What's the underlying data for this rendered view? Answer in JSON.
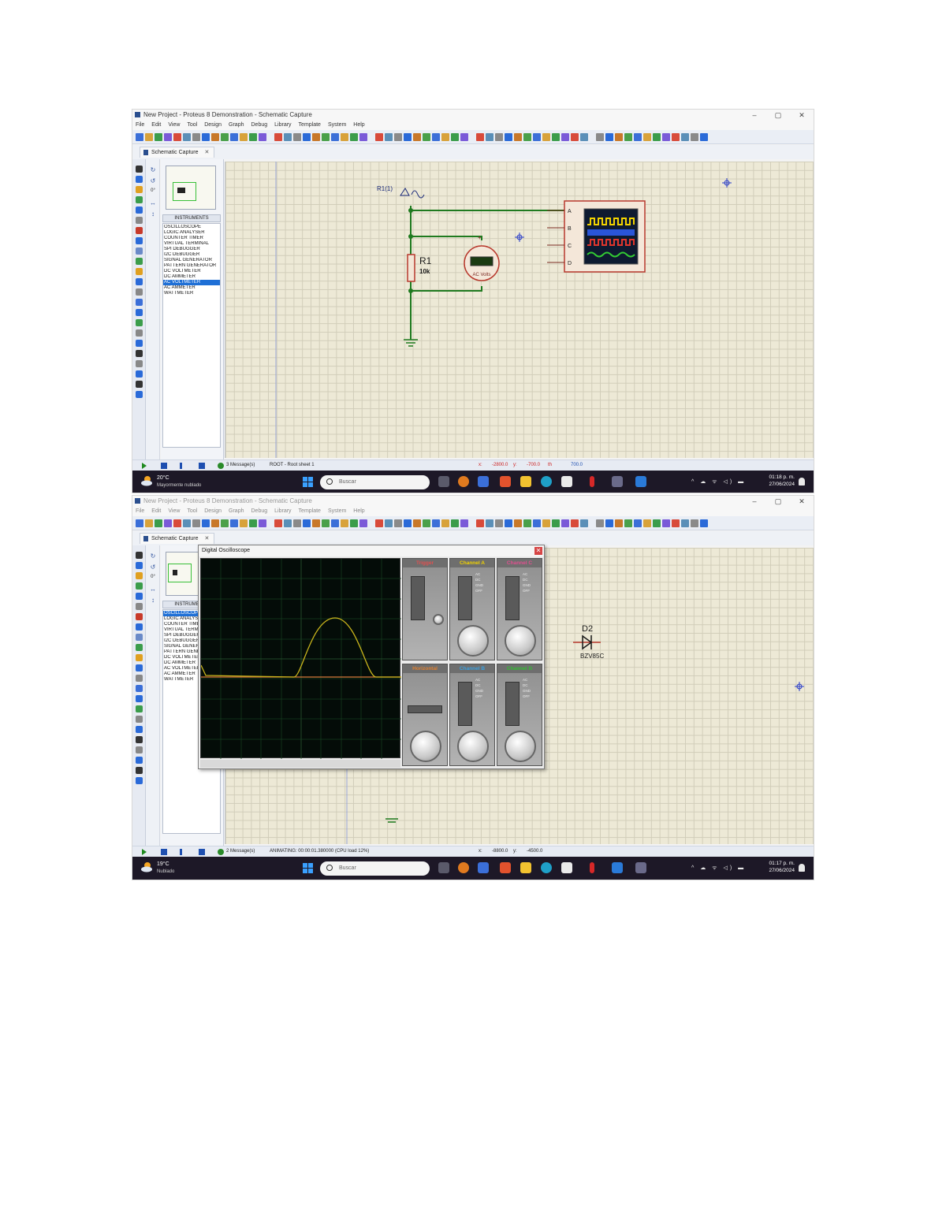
{
  "screenshots": [
    {
      "window_title": "New Project - Proteus 8 Demonstration - Schematic Capture",
      "window_controls": [
        "–",
        "▢",
        "✕"
      ],
      "menu": [
        "File",
        "Edit",
        "View",
        "Tool",
        "Design",
        "Graph",
        "Debug",
        "Library",
        "Template",
        "System",
        "Help"
      ],
      "tab_label": "Schematic Capture",
      "tab_close": "✕",
      "panel_header": "INSTRUMENTS",
      "instruments": [
        "OSCILLOSCOPE",
        "LOGIC ANALYSER",
        "COUNTER TIMER",
        "VIRTUAL TERMINAL",
        "SPI DEBUGGER",
        "I2C DEBUGGER",
        "SIGNAL GENERATOR",
        "PATTERN GENERATOR",
        "DC VOLTMETER",
        "DC AMMETER",
        "AC VOLTMETER",
        "AC AMMETER",
        "WATTMETER"
      ],
      "selected_instrument": "AC VOLTMETER",
      "rotation_value": "0°",
      "schematic": {
        "source_label": "R1(1)",
        "resistor_name": "R1",
        "resistor_value": "10k",
        "meter_label": "AC Volts",
        "scope_channels": [
          "A",
          "B",
          "C",
          "D"
        ]
      },
      "status": {
        "messages": "3 Message(s)",
        "sheet": "ROOT - Root sheet 1",
        "coord_x_label": "x:",
        "coord_x": "-2800.0",
        "coord_y_label": "y:",
        "coord_y": "-700.0",
        "units": "th",
        "extra": "700.0"
      },
      "taskbar": {
        "temperature": "20°C",
        "weather": "Mayormente nublado",
        "search_placeholder": "Buscar",
        "time": "01:18 p. m.",
        "date": "27/06/2024"
      }
    },
    {
      "window_title": "New Project - Proteus 8 Demonstration - Schematic Capture",
      "window_controls": [
        "–",
        "▢",
        "✕"
      ],
      "menu": [
        "File",
        "Edit",
        "View",
        "Tool",
        "Design",
        "Graph",
        "Debug",
        "Library",
        "Template",
        "System",
        "Help"
      ],
      "tab_label": "Schematic Capture",
      "tab_close": "✕",
      "panel_header": "INSTRUMENTS",
      "instruments": [
        "OSCILLOSCOPE",
        "LOGIC ANALYSER",
        "COUNTER TIMER",
        "VIRTUAL TERMINAL",
        "SPI DEBUGGER",
        "I2C DEBUGGER",
        "SIGNAL GENERATOR",
        "PATTERN GENERATOR",
        "DC VOLTMETER",
        "DC AMMETER",
        "AC VOLTMETER",
        "AC AMMETER",
        "WATTMETER"
      ],
      "selected_instrument": "OSCILLOSCOPE",
      "rotation_value": "0°",
      "schematic": {
        "diode_name": "D2",
        "diode_part": "BZV85C"
      },
      "scope": {
        "title": "Digital Oscilloscope",
        "close": "✕",
        "panels": [
          "Trigger",
          "Channel A",
          "Channel C",
          "Horizontal",
          "Channel B",
          "Channel D"
        ],
        "panel_colors": [
          "#e05050",
          "#f2d300",
          "#e05090",
          "#e08030",
          "#3aa0e0",
          "#30c030"
        ]
      },
      "status": {
        "messages": "2 Message(s)",
        "sheet": "ANIMATING: 00:00:01.380000 (CPU load 12%)",
        "coord_x_label": "x:",
        "coord_x": "-8800.0",
        "coord_y_label": "y:",
        "coord_y": "-4500.0"
      },
      "taskbar": {
        "temperature": "19°C",
        "weather": "Nublado",
        "search_placeholder": "Buscar",
        "time": "01:17 p. m.",
        "date": "27/06/2024"
      }
    }
  ],
  "colors": {
    "wire": "#1f7a1f",
    "component": "#b8392d",
    "canvas": "#ede9d6",
    "selection": "#1e6fd6",
    "taskbar": "#1d1827"
  }
}
